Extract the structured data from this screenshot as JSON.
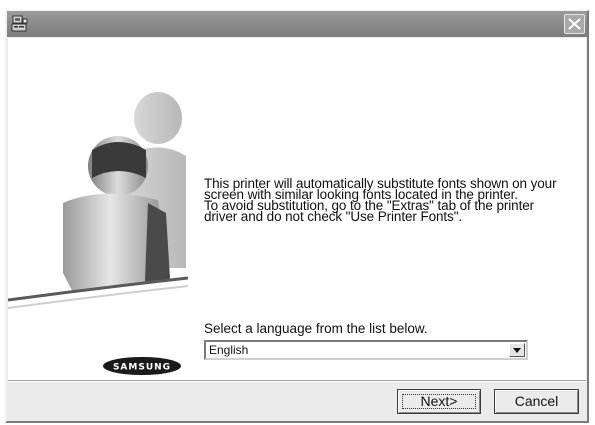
{
  "window": {
    "colors": {
      "titlebar": "#8a8a8a",
      "face": "#ebebeb",
      "content": "#ffffff"
    },
    "icons": {
      "app": "installer-icon",
      "close": "close-icon"
    }
  },
  "message": {
    "lines": [
      "This printer will automatically substitute fonts shown on your",
      "screen with similar looking fonts located in the printer.",
      "To avoid substitution, go to the \"Extras\" tab of the printer",
      "driver and do not check \"Use Printer Fonts\"."
    ]
  },
  "language": {
    "label": "Select a language from the list below.",
    "selected": "English"
  },
  "buttons": {
    "next": "Next>",
    "cancel": "Cancel"
  },
  "branding": {
    "logo_text": "SAMSUNG"
  }
}
